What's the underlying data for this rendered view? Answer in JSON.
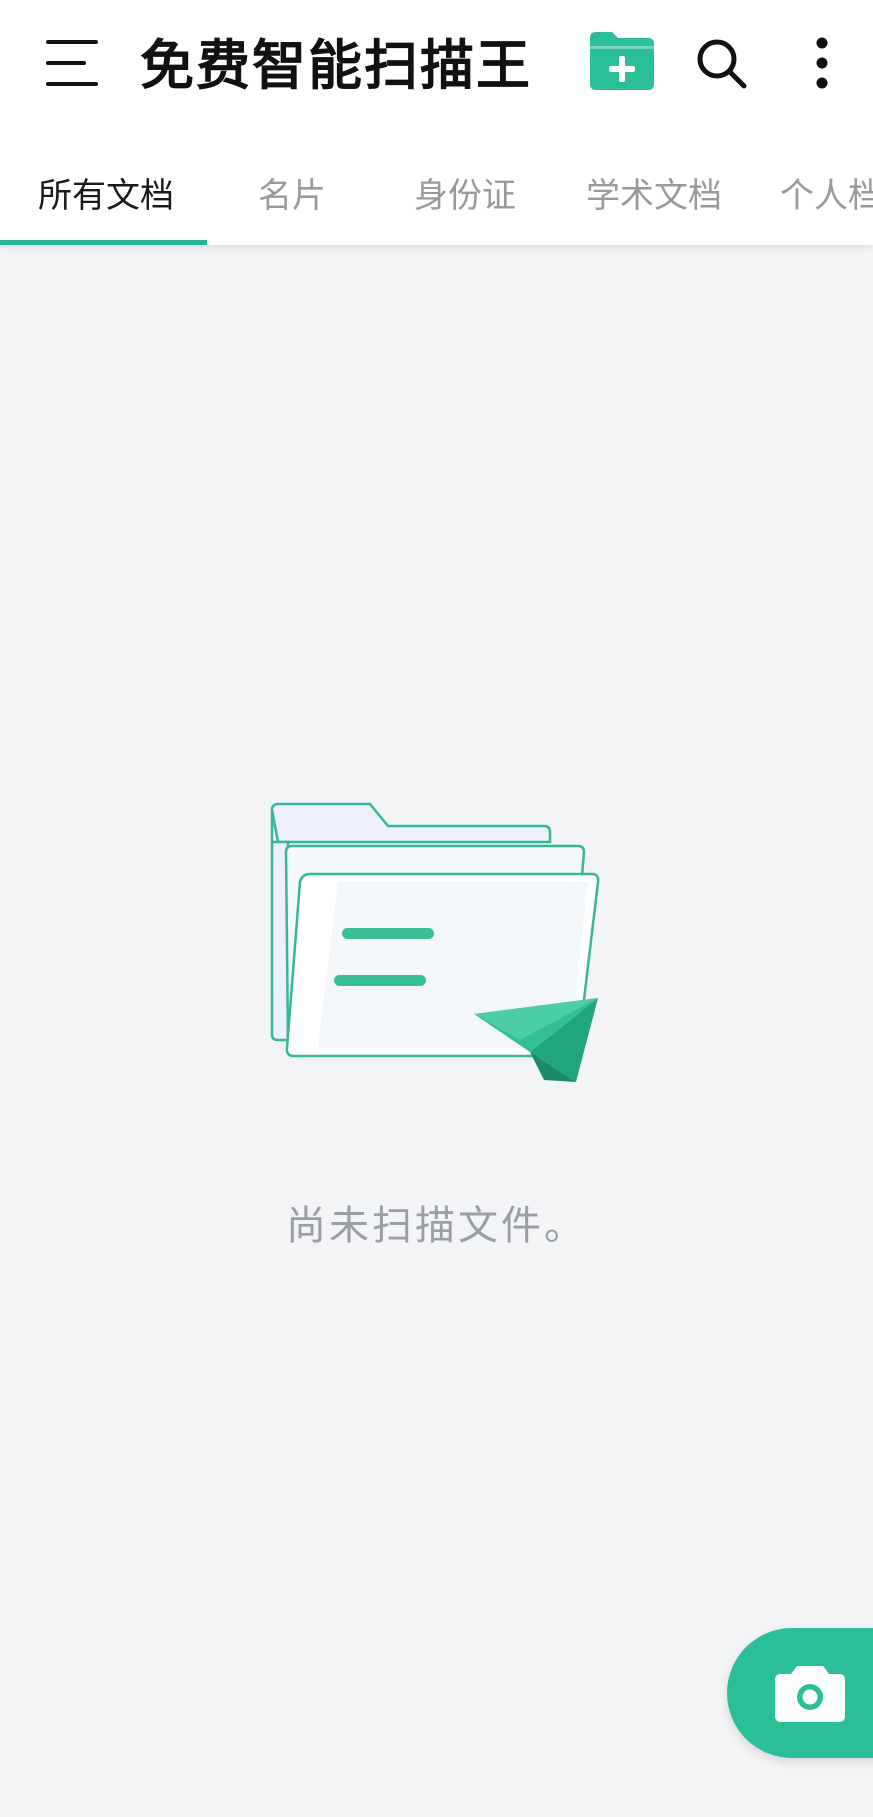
{
  "header": {
    "title": "免费智能扫描王",
    "accent_color": "#2bbf98",
    "icons": {
      "menu": "menu-icon",
      "new_folder": "folder-plus-icon",
      "search": "search-icon",
      "more": "more-vertical-icon"
    }
  },
  "tabs": [
    {
      "label": "所有文档",
      "active": true
    },
    {
      "label": "名片",
      "active": false
    },
    {
      "label": "身份证",
      "active": false
    },
    {
      "label": "学术文档",
      "active": false
    },
    {
      "label": "个人档",
      "active": false
    }
  ],
  "empty_state": {
    "message": "尚未扫描文件。",
    "illustration": "empty-folder-paper-plane-illustration"
  },
  "fab": {
    "icon": "camera-icon"
  }
}
